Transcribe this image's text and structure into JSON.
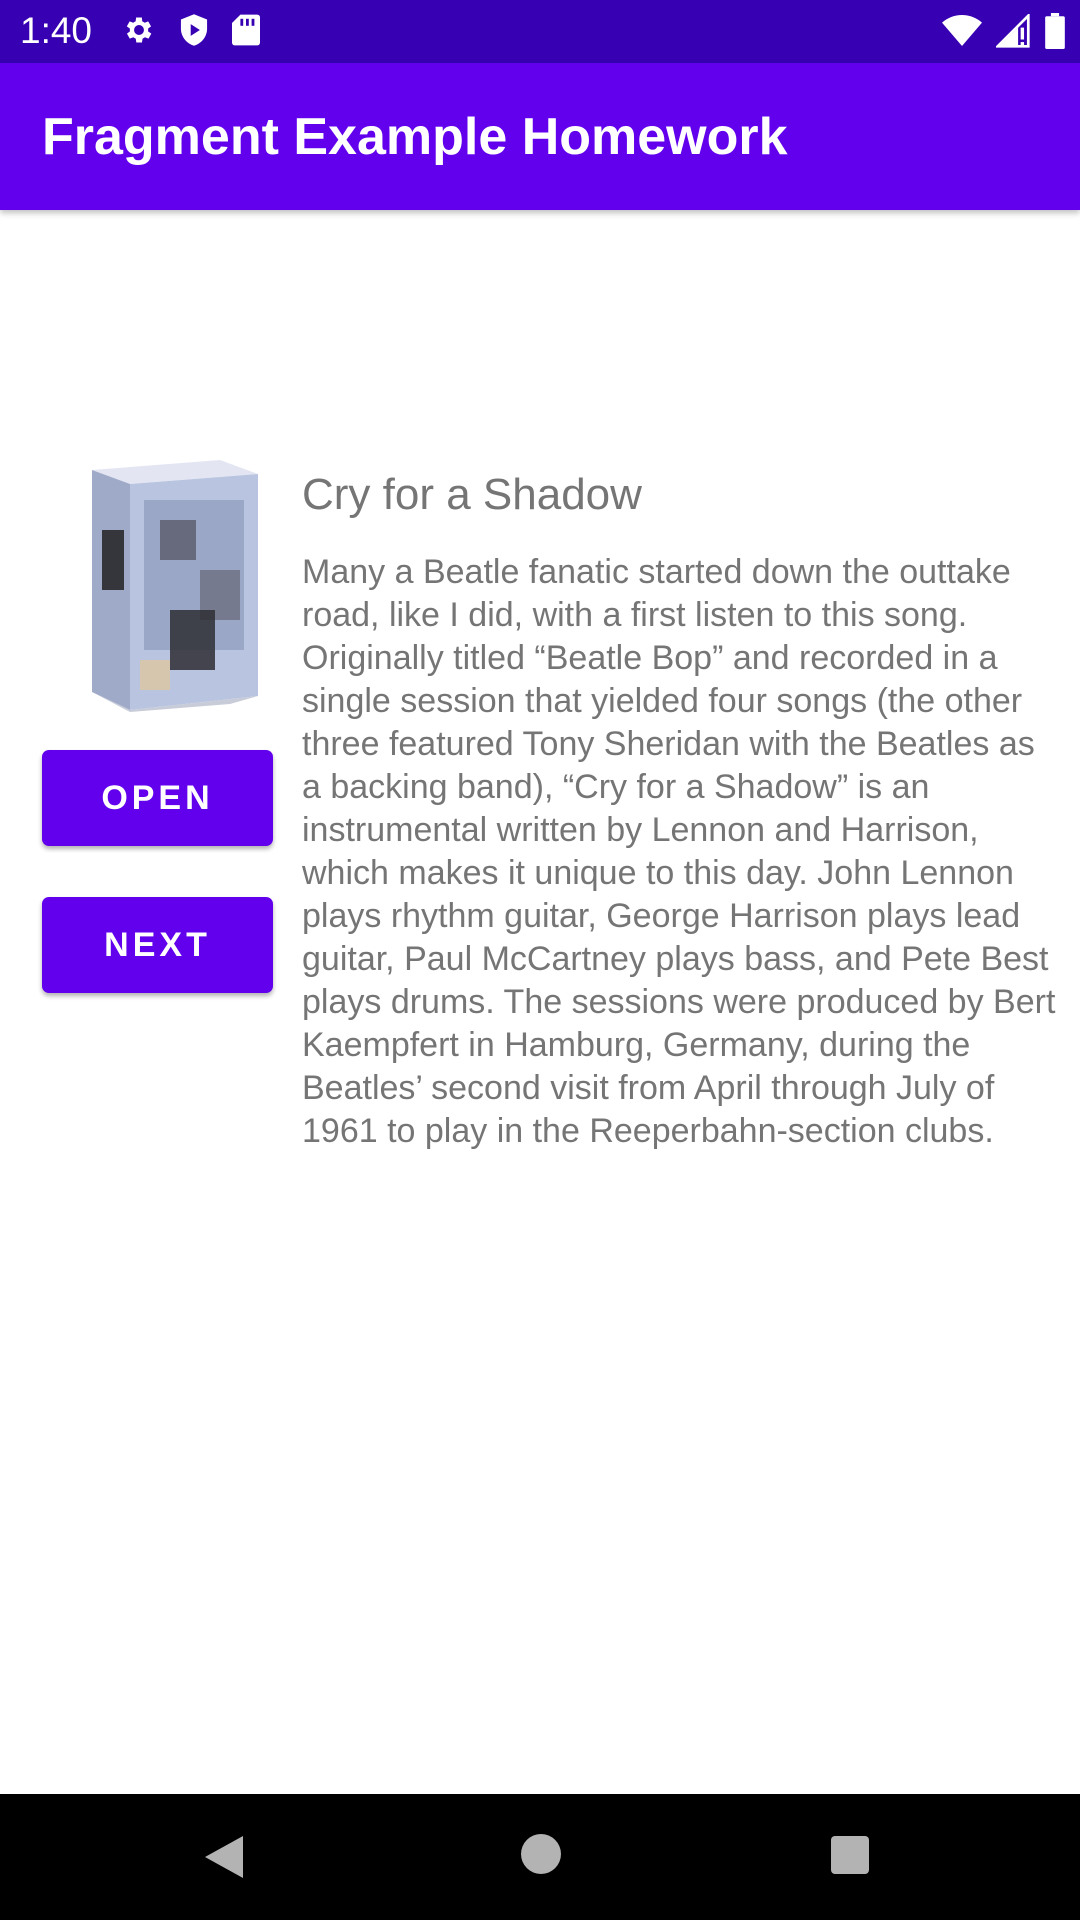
{
  "status_bar": {
    "time": "1:40",
    "left_icons": [
      "gear-icon",
      "play-protect-icon",
      "sd-card-icon"
    ],
    "right_icons": [
      "wifi-icon",
      "signal-icon",
      "battery-icon"
    ]
  },
  "app_bar": {
    "title": "Fragment Example Homework",
    "color": "#6200ee"
  },
  "album": {
    "icon": "album-cover-image"
  },
  "buttons": {
    "open_label": "OPEN",
    "next_label": "NEXT",
    "color": "#6200ee"
  },
  "song": {
    "title": "Cry for a Shadow",
    "description": "Many a Beatle fanatic started down the outtake road, like I did, with a first listen to this song. Originally titled “Beatle Bop” and recorded in a single session that yielded four songs (the other three featured Tony Sheridan with the Beatles as a backing band), “Cry for a Shadow” is an instrumental written by Lennon and Harrison, which makes it unique to this day. John Lennon plays rhythm guitar, George Harrison plays lead guitar, Paul McCartney plays bass, and Pete Best plays drums. The sessions were produced by Bert Kaempfert in Hamburg, Germany, during the Beatles’ second visit from April through July of 1961 to play in the Reeperbahn-section clubs."
  },
  "nav_bar": {
    "icons": [
      "back-icon",
      "home-icon",
      "recents-icon"
    ]
  }
}
